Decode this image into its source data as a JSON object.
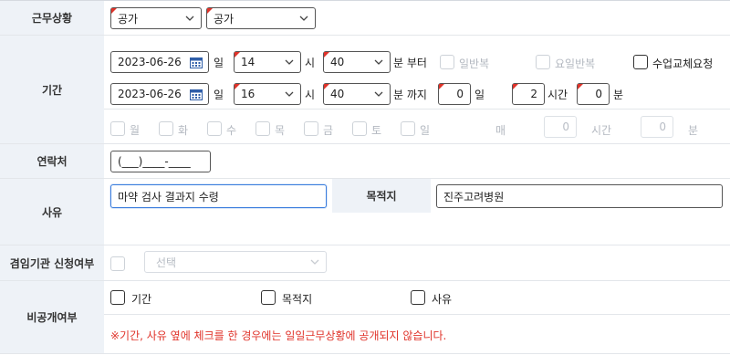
{
  "work_status": {
    "label": "근무상황",
    "select1": "공가",
    "select2": "공가"
  },
  "period": {
    "label": "기간",
    "start": {
      "date": "2023-06-26",
      "day_label": "일",
      "hour": "14",
      "hour_label": "시",
      "minute": "40",
      "minute_label": "분 부터"
    },
    "end": {
      "date": "2023-06-26",
      "day_label": "일",
      "hour": "16",
      "hour_label": "시",
      "minute": "40",
      "minute_label": "분 까지"
    },
    "daily_repeat": "일반복",
    "weekday_repeat": "요일반복",
    "class_exchange": "수업교체요청",
    "duration": {
      "days": "0",
      "days_label": "일",
      "hours": "2",
      "hours_label": "시간",
      "minutes": "0",
      "minutes_label": "분"
    },
    "weekdays": [
      "월",
      "화",
      "수",
      "목",
      "금",
      "토",
      "일"
    ],
    "every_label": "매",
    "every_hours": "0",
    "every_hours_label": "시간",
    "every_minutes": "0",
    "every_minutes_label": "분"
  },
  "contact": {
    "label": "연락처",
    "value": "(___)____-____"
  },
  "reason": {
    "label": "사유",
    "value": "마약 검사 결과지 수령",
    "destination_label": "목적지",
    "destination_value": "진주고려병원"
  },
  "dual_office": {
    "label": "겸임기관 신청여부",
    "select_placeholder": "선택"
  },
  "private": {
    "label": "비공개여부",
    "options": [
      "기간",
      "목적지",
      "사유"
    ],
    "notice": "※기간, 사유 옆에 체크를 한 경우에는 일일근무상황에 공개되지 않습니다."
  },
  "colors": {
    "label_bg": "#eef2f7",
    "notice": "#e0342b",
    "focus_border": "#3b7ddd",
    "required_marker": "#e0342b"
  }
}
